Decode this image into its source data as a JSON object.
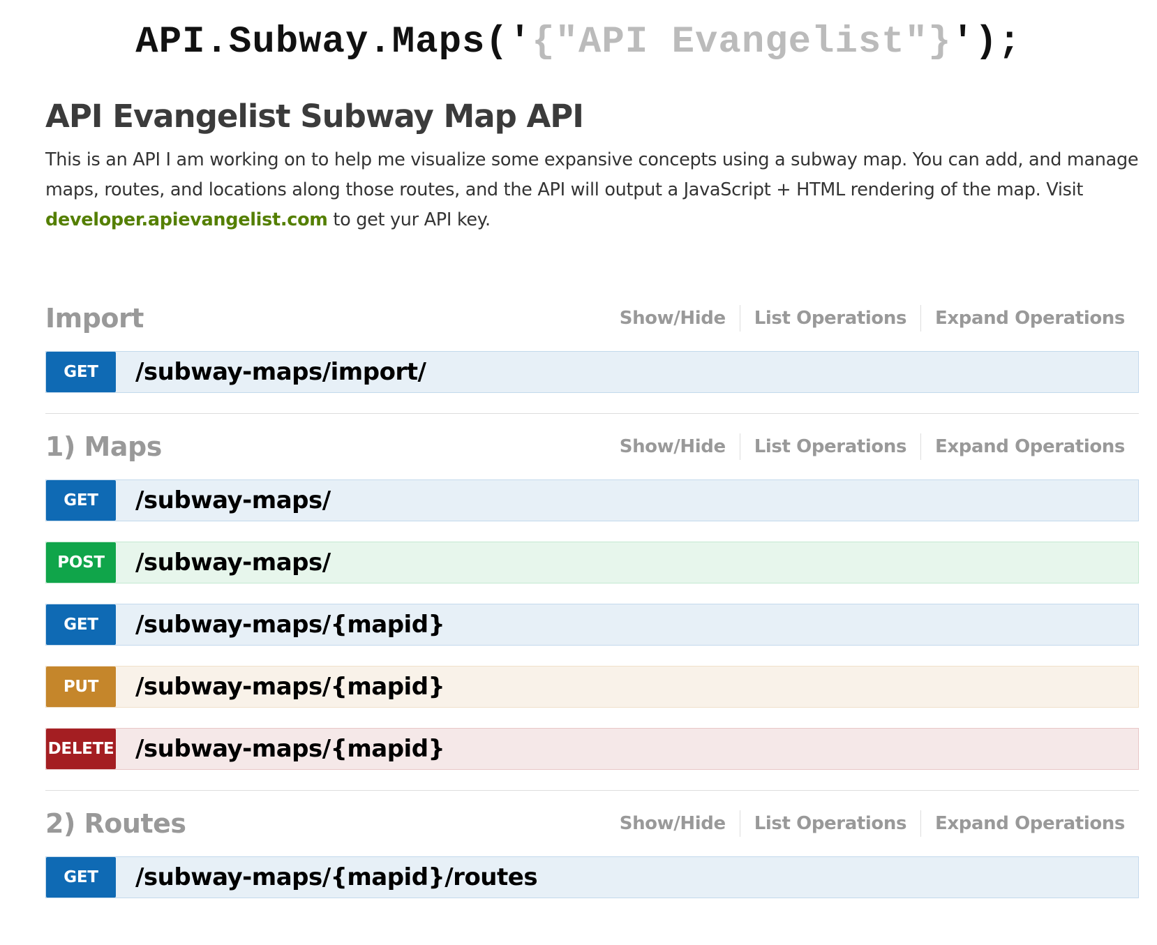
{
  "logo": {
    "prefix": "API.Subway.Maps('",
    "argument": "{\"API Evangelist\"}",
    "suffix": "');"
  },
  "info": {
    "title": "API Evangelist Subway Map API",
    "description_before_link": "This is an API I am working on to help me visualize some expansive concepts using a subway map. You can add, and manage maps, routes, and locations along those routes, and the API will output a JavaScript + HTML rendering of the map. Visit ",
    "link_text": "developer.apievangelist.com",
    "description_after_link": " to get yur API key."
  },
  "resources": [
    {
      "name": "Import",
      "actions": [
        "Show/Hide",
        "List Operations",
        "Expand Operations"
      ],
      "operations": [
        {
          "method": "GET",
          "path": "/subway-maps/import/"
        }
      ]
    },
    {
      "name": "1) Maps",
      "actions": [
        "Show/Hide",
        "List Operations",
        "Expand Operations"
      ],
      "operations": [
        {
          "method": "GET",
          "path": "/subway-maps/"
        },
        {
          "method": "POST",
          "path": "/subway-maps/"
        },
        {
          "method": "GET",
          "path": "/subway-maps/{mapid}"
        },
        {
          "method": "PUT",
          "path": "/subway-maps/{mapid}"
        },
        {
          "method": "DELETE",
          "path": "/subway-maps/{mapid}"
        }
      ]
    },
    {
      "name": "2) Routes",
      "actions": [
        "Show/Hide",
        "List Operations",
        "Expand Operations"
      ],
      "operations": [
        {
          "method": "GET",
          "path": "/subway-maps/{mapid}/routes"
        }
      ]
    }
  ],
  "colors": {
    "get": "#0f6ab4",
    "post": "#10a54a",
    "put": "#c5862b",
    "delete": "#a41e22",
    "link": "#547f00"
  }
}
